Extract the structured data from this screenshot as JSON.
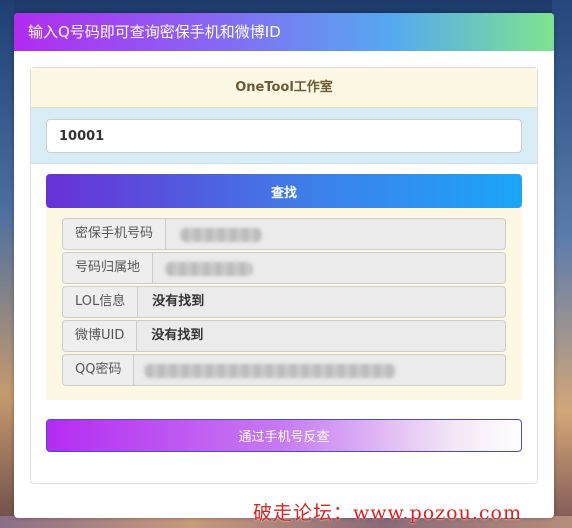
{
  "header": {
    "title": "输入Q号码即可查询密保手机和微博ID"
  },
  "card": {
    "title": "OneTool工作室"
  },
  "search": {
    "value": "10001"
  },
  "buttons": {
    "search_label": "查找",
    "reverse_label": "通过手机号反查"
  },
  "results": {
    "rows": [
      {
        "label": "密保手机号码",
        "value": ""
      },
      {
        "label": "号码归属地",
        "value": ""
      },
      {
        "label": "LOL信息",
        "value": "没有找到"
      },
      {
        "label": "微博UID",
        "value": "没有找到"
      },
      {
        "label": "QQ密码",
        "value": ""
      }
    ]
  },
  "watermark": {
    "text": "破走论坛：www.pozou.com"
  }
}
